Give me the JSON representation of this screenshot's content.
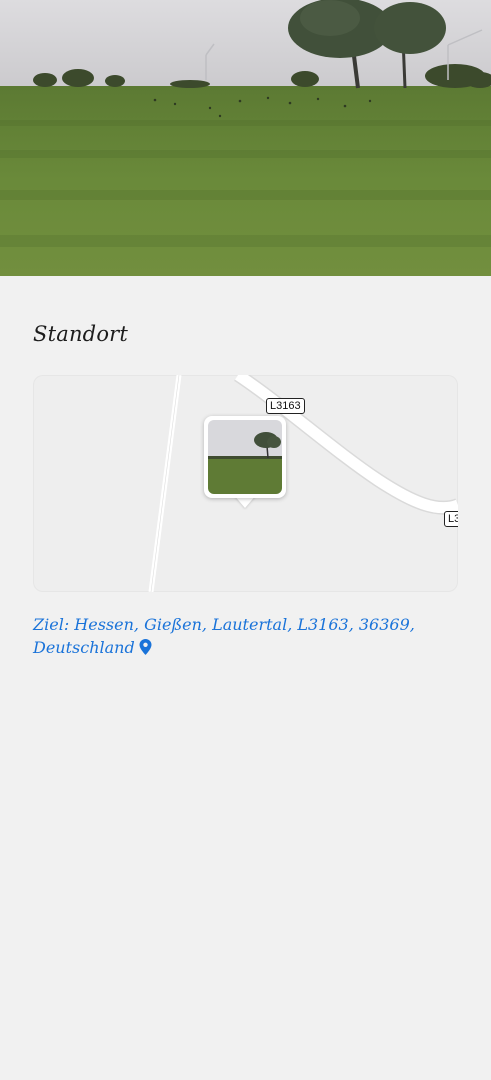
{
  "section": {
    "title": "Standort"
  },
  "map": {
    "road_labels": [
      "L3163",
      "L3"
    ],
    "background_color": "#eeeeee",
    "road_color": "#ffffff"
  },
  "address": {
    "text": "Ziel: Hessen, Gießen, Lautertal, L3163, 36369, Deutschland",
    "icon": "location-pin-icon",
    "color": "#1a73d9"
  }
}
